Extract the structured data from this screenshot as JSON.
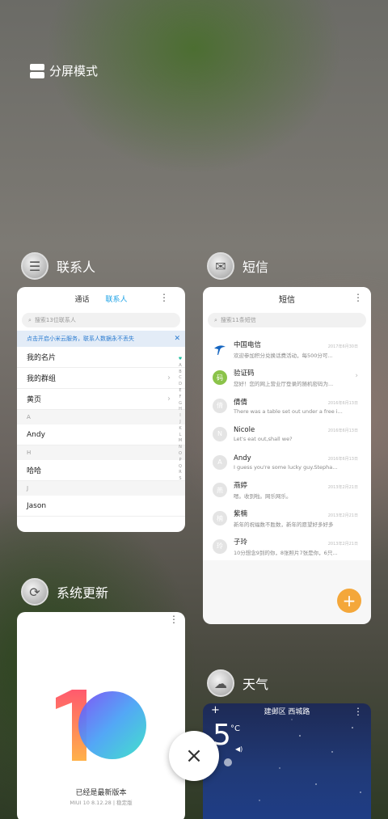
{
  "split_mode": {
    "label": "分屏模式",
    "icon": "split-screen-icon"
  },
  "apps": {
    "contacts": {
      "name": "联系人",
      "icon": "contacts-icon",
      "tabs": [
        "通话",
        "联系人"
      ],
      "active_tab": "联系人",
      "search_placeholder": "搜索13位联系人",
      "banner": "点击开启小米云服务，联系人数据永不丢失",
      "rows": [
        {
          "type": "item",
          "label": "我的名片"
        },
        {
          "type": "item",
          "label": "我的群组",
          "chevron": true
        },
        {
          "type": "item",
          "label": "黄页",
          "chevron": true
        },
        {
          "type": "section",
          "label": "A"
        },
        {
          "type": "item",
          "label": "Andy"
        },
        {
          "type": "section",
          "label": "H"
        },
        {
          "type": "item",
          "label": "哈哈"
        },
        {
          "type": "section",
          "label": "J"
        },
        {
          "type": "item",
          "label": "Jason"
        }
      ],
      "alphabet": [
        "♥",
        "A",
        "B",
        "C",
        "D",
        "E",
        "F",
        "G",
        "H",
        "I",
        "J",
        "K",
        "L",
        "M",
        "N",
        "O",
        "P",
        "Q",
        "R",
        "S"
      ]
    },
    "sms": {
      "name": "短信",
      "icon": "sms-icon",
      "title": "短信",
      "search_placeholder": "搜索11条短信",
      "messages": [
        {
          "name": "中国电信",
          "preview": "欢迎参加积分兑换话费活动，每500分可...",
          "time": "2017年6月30日",
          "avatar": "",
          "avatar_color": "#ffffff"
        },
        {
          "name": "验证码",
          "preview": "您好！您的网上营业厅登录的随机密码为...",
          "time": "",
          "avatar": "码",
          "avatar_color": "#8bc34a"
        },
        {
          "name": "倩倩",
          "preview": "There was a table set out under a free i...",
          "time": "2016年6月13日",
          "avatar": "倩",
          "avatar_color": "#e4e4e4"
        },
        {
          "name": "Nicole",
          "preview": "Let's eat out,shall we?",
          "time": "2016年6月13日",
          "avatar": "N",
          "avatar_color": "#e4e4e4"
        },
        {
          "name": "Andy",
          "preview": "I guess you're some lucky guy.Stepha...",
          "time": "2016年6月13日",
          "avatar": "A",
          "avatar_color": "#e4e4e4"
        },
        {
          "name": "燕婷",
          "preview": "嗯。收到啦。网乐网乐。",
          "time": "2013年2月21日",
          "avatar": "燕",
          "avatar_color": "#e4e4e4"
        },
        {
          "name": "紫楠",
          "preview": "新年的祝福数不胜数，新年的愿望好多好多",
          "time": "2013年2月21日",
          "avatar": "楠",
          "avatar_color": "#e4e4e4"
        },
        {
          "name": "子玲",
          "preview": "10分想念9到的你，8张照片7张是你，6只...",
          "time": "2013年2月21日",
          "avatar": "玲",
          "avatar_color": "#e4e4e4"
        }
      ],
      "fab_label": "+"
    },
    "updater": {
      "name": "系统更新",
      "icon": "refresh-icon",
      "logo_text": "10",
      "status": "已经是最新版本",
      "version": "MIUI 10 8.12.28 | 稳定版"
    },
    "weather": {
      "name": "天气",
      "icon": "cloud-icon",
      "location": "建邺区 西城路",
      "temperature": "5",
      "unit": "°C"
    }
  },
  "close_button": {
    "label": "×",
    "icon": "close-icon"
  }
}
